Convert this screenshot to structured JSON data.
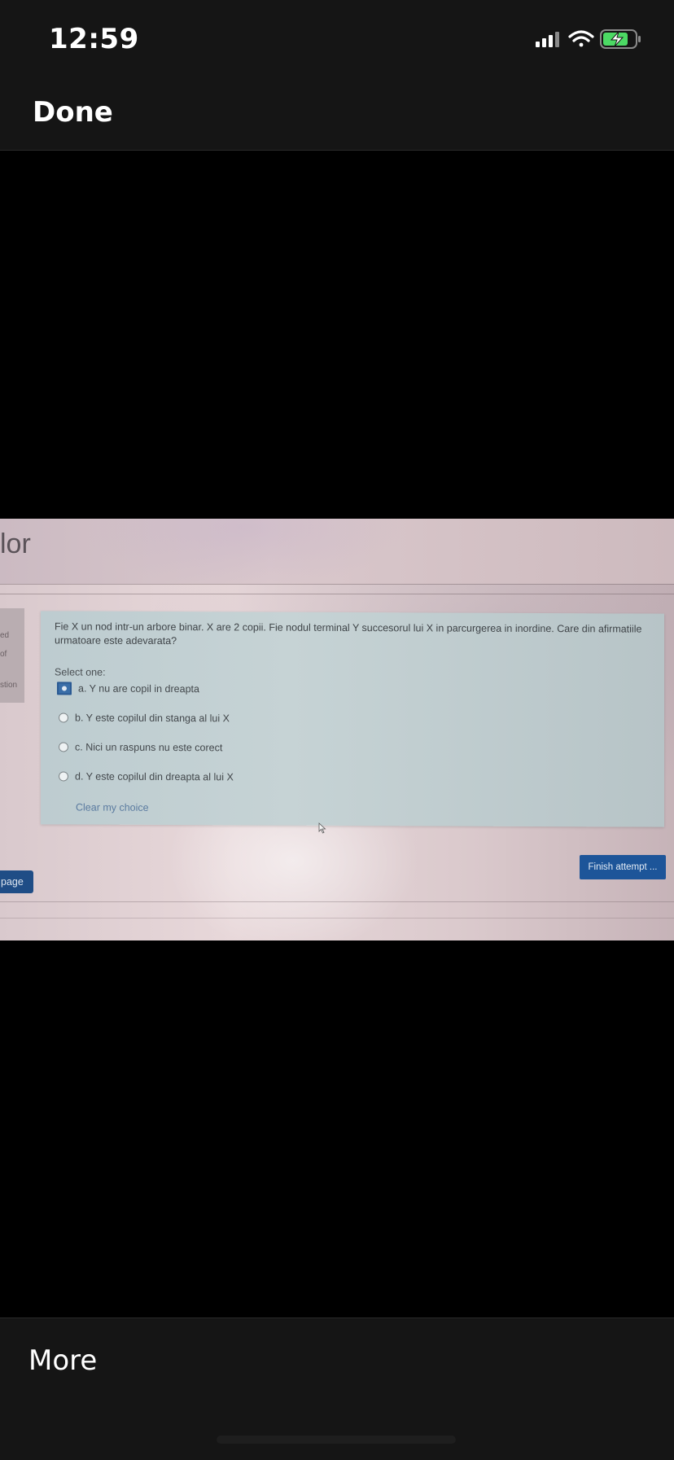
{
  "status_bar": {
    "time": "12:59",
    "signal_icon": "cellular-signal-icon",
    "wifi_icon": "wifi-icon",
    "battery_icon": "battery-charging-icon",
    "battery_color": "#4cd964"
  },
  "nav": {
    "done_label": "Done"
  },
  "photo": {
    "header_partial_title": "lor",
    "left_fragments": [
      "ed",
      "of",
      "stion"
    ],
    "question_text": "Fie X un nod intr-un arbore binar. X are 2 copii. Fie nodul terminal Y succesorul lui X in parcurgerea in inordine. Care din afirmatiile urmatoare este adevarata?",
    "select_label": "Select one:",
    "options": [
      {
        "label": "a. Y nu are copil in dreapta",
        "selected": true
      },
      {
        "label": "b. Y este copilul din stanga al lui X",
        "selected": false
      },
      {
        "label": "c. Nici un raspuns nu este corect",
        "selected": false
      },
      {
        "label": "d. Y este copilul din dreapta al lui X",
        "selected": false
      }
    ],
    "clear_link": "Clear my choice",
    "finish_button": "Finish attempt ...",
    "page_button": "page",
    "accent_color": "#1d5599"
  },
  "bottom_bar": {
    "more_label": "More"
  }
}
